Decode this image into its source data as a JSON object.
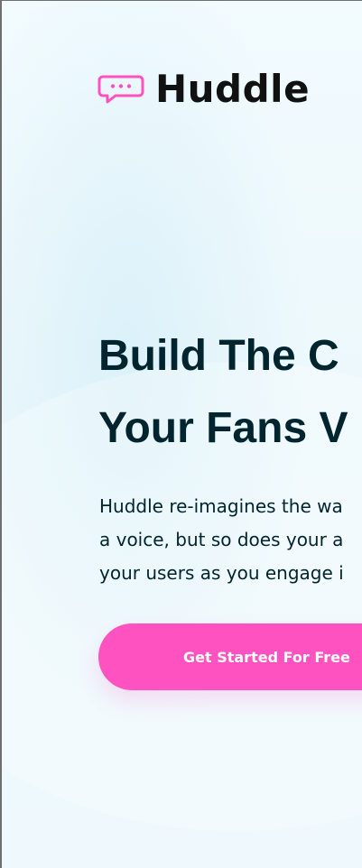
{
  "brand": {
    "name": "Huddle",
    "icon": "chat-bubble-icon",
    "accent_color": "#ff52c1"
  },
  "hero": {
    "headline_lines": [
      "Build The C",
      "Your Fans V"
    ],
    "description_lines": [
      "Huddle re-imagines the wa",
      "a voice, but so does your a",
      "your users as you engage i"
    ],
    "cta_label": "Get Started For Free"
  },
  "colors": {
    "background": "#eef9fd",
    "text": "#00252e",
    "button": "#ff52c1",
    "button_text": "#ffffff"
  }
}
